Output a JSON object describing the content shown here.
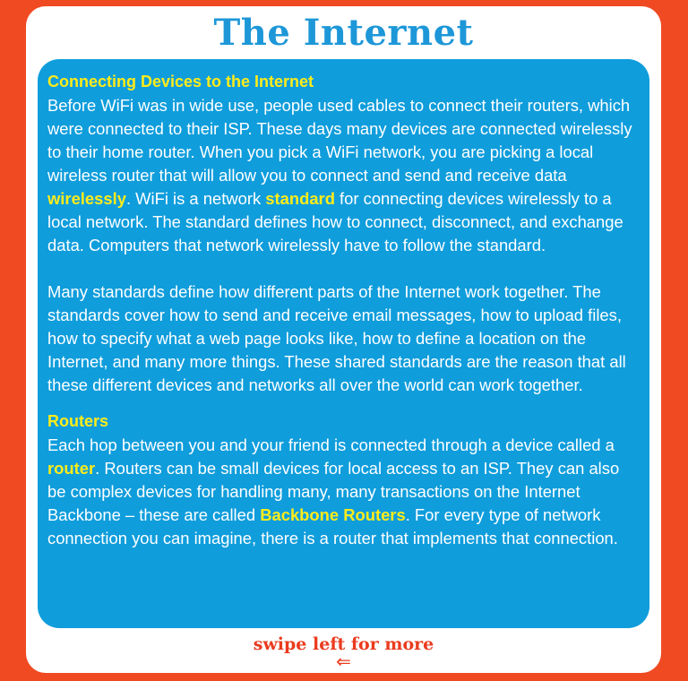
{
  "title": "The Internet",
  "section1": {
    "heading": "Connecting Devices to the Internet",
    "p1": {
      "before_wirelessly": "Before WiFi was in wide use, people used cables to connect their routers, which were connected to their ISP. These days many devices are connected wirelessly to their home router. When you pick a WiFi network, you are picking a local wireless router that will allow you to connect and send and receive data ",
      "wirelessly": "wirelessly",
      "between": ". WiFi is a network ",
      "standard": "standard",
      "after_standard": " for connecting devices wirelessly to a local network. The standard defines how to connect, disconnect, and exchange data. Computers that network wirelessly have to follow the standard."
    },
    "p2": "Many standards define how different parts of the Internet work together. The standards cover how to send and receive email messages, how to upload files, how to specify what a web page looks like, how to define a location on the Internet, and many more things. These shared standards are the reason that all these different devices and networks all over the world can work together."
  },
  "section2": {
    "heading": "Routers",
    "p1": {
      "before_router": "Each hop between you and your friend is connected through a device called a ",
      "router": "router",
      "between": ". Routers can be small devices for local access to an ISP. They can also be complex devices for handling many, many transactions on the Internet Backbone – these are called ",
      "backbone": "Backbone Routers",
      "after_backbone": ". For every type of network connection you can imagine, there is a router that implements that connection."
    }
  },
  "footer": {
    "swipe_label": "swipe left for more",
    "arrow_icon": "left-arrow-icon"
  },
  "colors": {
    "background": "#f04a23",
    "card": "#ffffff",
    "panel": "#0f9ddc",
    "title": "#1d97d8",
    "highlight": "#ffec1a",
    "footer": "#ea3b1e"
  }
}
